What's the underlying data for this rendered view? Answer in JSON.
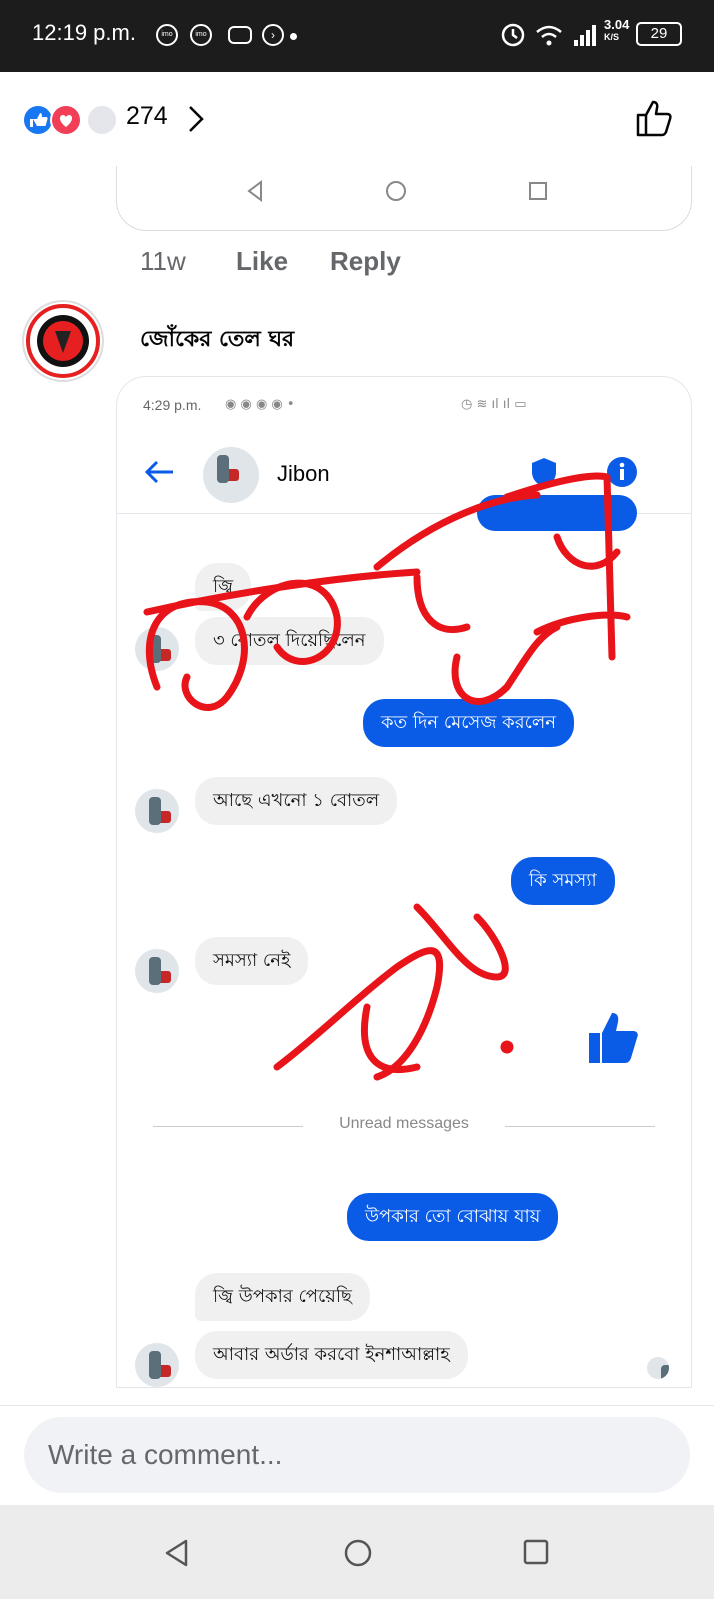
{
  "status_bar": {
    "time": "12:19 p.m.",
    "icons": [
      "imo-icon",
      "imo-icon",
      "game-controller-icon",
      "media-icon",
      "dot-icon"
    ],
    "right_icons": [
      "alarm-icon",
      "wifi-icon",
      "signal-icon"
    ],
    "speed": "3.04",
    "speed_unit": "K/S",
    "battery": "29"
  },
  "reactions": {
    "types": [
      "like",
      "love",
      "care"
    ],
    "count": "274",
    "like_color": "#1877f2",
    "love_color": "#f33e58"
  },
  "previous_comment": {
    "age": "11w",
    "like_label": "Like",
    "reply_label": "Reply"
  },
  "comment": {
    "author": "জোঁকের তেল ঘর",
    "screenshot": {
      "status_time": "4:29 p.m.",
      "contact_name": "Jibon",
      "accent_color": "#0a5ce6",
      "messages": [
        {
          "side": "in",
          "text": "জ্বি"
        },
        {
          "side": "in",
          "text": "৩ বোতল দিয়েছিলেন"
        },
        {
          "side": "out",
          "text": "কত দিন মেসেজ করলেন"
        },
        {
          "side": "in",
          "text": "আছে এখনো ১ বোতল"
        },
        {
          "side": "out",
          "text": "কি সমস্যা"
        },
        {
          "side": "in",
          "text": "সমস্যা নেই"
        },
        {
          "side": "in",
          "text": "জ্বি উপকার পেয়েছি"
        },
        {
          "side": "in",
          "text": "আবার অর্ডার করবো ইনশাআল্লাহ"
        }
      ],
      "out_message_bottom": "উপকার তো বোঝায় যায়",
      "divider_label": "Unread messages",
      "overlay_color": "#e8141a"
    }
  },
  "composer": {
    "placeholder": "Write a comment..."
  }
}
